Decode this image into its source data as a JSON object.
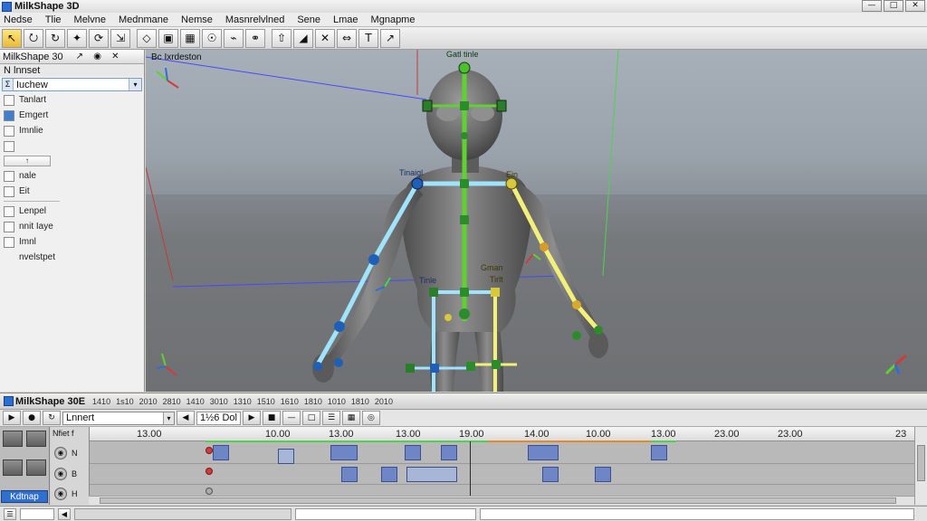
{
  "window": {
    "title": "MilkShape 3D",
    "controls": [
      "—",
      "□",
      "✕"
    ]
  },
  "menu": [
    "Nedse",
    "Tlie",
    "Melvne",
    "Mednmane",
    "Nemse",
    "Masnrelvlned",
    "Sene",
    "Lmae",
    "Mgnapme"
  ],
  "toolbar": {
    "icons": [
      "cursor-icon",
      "select-icon",
      "lasso-icon",
      "move-icon",
      "rotate-icon",
      "scale-icon",
      "vertex-icon",
      "face-icon",
      "group-icon",
      "joint-icon",
      "bone-icon",
      "link-icon",
      "extrude-icon",
      "bevel-icon",
      "weld-icon",
      "mirror-icon",
      "text-icon",
      "measure-icon"
    ],
    "glyphs": [
      "↖",
      "⭮",
      "↻",
      "✦",
      "⟳",
      "⇲",
      "◇",
      "▣",
      "▦",
      "☉",
      "⌁",
      "⚭",
      "⇧",
      "◢",
      "✕",
      "⇔",
      "T",
      "↗"
    ]
  },
  "left_panel": {
    "header": "MilkShape 30",
    "header_tools": "↗ ◉ ✕",
    "section": "N lnnset",
    "combo_value": "Iuchew",
    "rows": [
      {
        "label": "Tanlart",
        "icon": "layer-icon",
        "style": ""
      },
      {
        "label": "Emgert",
        "icon": "material-icon",
        "style": "blue"
      },
      {
        "label": "Imnlie",
        "icon": "list-icon",
        "style": ""
      }
    ],
    "field_value": "↑",
    "rows2": [
      {
        "label": "nale",
        "icon": "edit-icon"
      },
      {
        "label": "Eit",
        "icon": "grid-icon"
      }
    ],
    "rows3": [
      {
        "label": "Lenpel",
        "icon": "link-icon"
      },
      {
        "label": "nnit Iaye",
        "icon": "lock-icon"
      },
      {
        "label": "Imnl",
        "icon": "pen-icon"
      },
      {
        "label": "nvelstpet",
        "icon": ""
      }
    ]
  },
  "viewport": {
    "label": "Bc Ixrdeston",
    "bone_labels": {
      "head": "Gatl tinle",
      "left_shoulder": "Tinaigl",
      "right_shoulder": "Ein",
      "hip_left": "Tinle",
      "hip_right": "Gman",
      "hip_right_sub": "Tirlt"
    }
  },
  "timeline": {
    "header_title": "MilkShape 30E",
    "tabs": [
      "1410",
      "1s10",
      "2010",
      "2810",
      "1410",
      "3010",
      "1310",
      "1510",
      "1610",
      "1810",
      "1010",
      "1810",
      "2010"
    ],
    "combo_value": "Lnnert",
    "value": "1½6 Dol",
    "track_labels": [
      "Nfiet f",
      "N",
      "B",
      "H"
    ],
    "ruler_ticks": [
      "13.00",
      "10.00",
      "13.00",
      "13.00",
      "19.00",
      "14.00",
      "10.00",
      "13.00",
      "23.00",
      "23.00",
      "23"
    ],
    "keyframe_button": "Kdtnap"
  },
  "colors": {
    "accent": "#2f6fcf",
    "bone_green": "#5ed22f",
    "bone_cyan": "#9fe3ff",
    "bone_yellow": "#f3f07a",
    "joint_blue": "#1f5fb8"
  }
}
